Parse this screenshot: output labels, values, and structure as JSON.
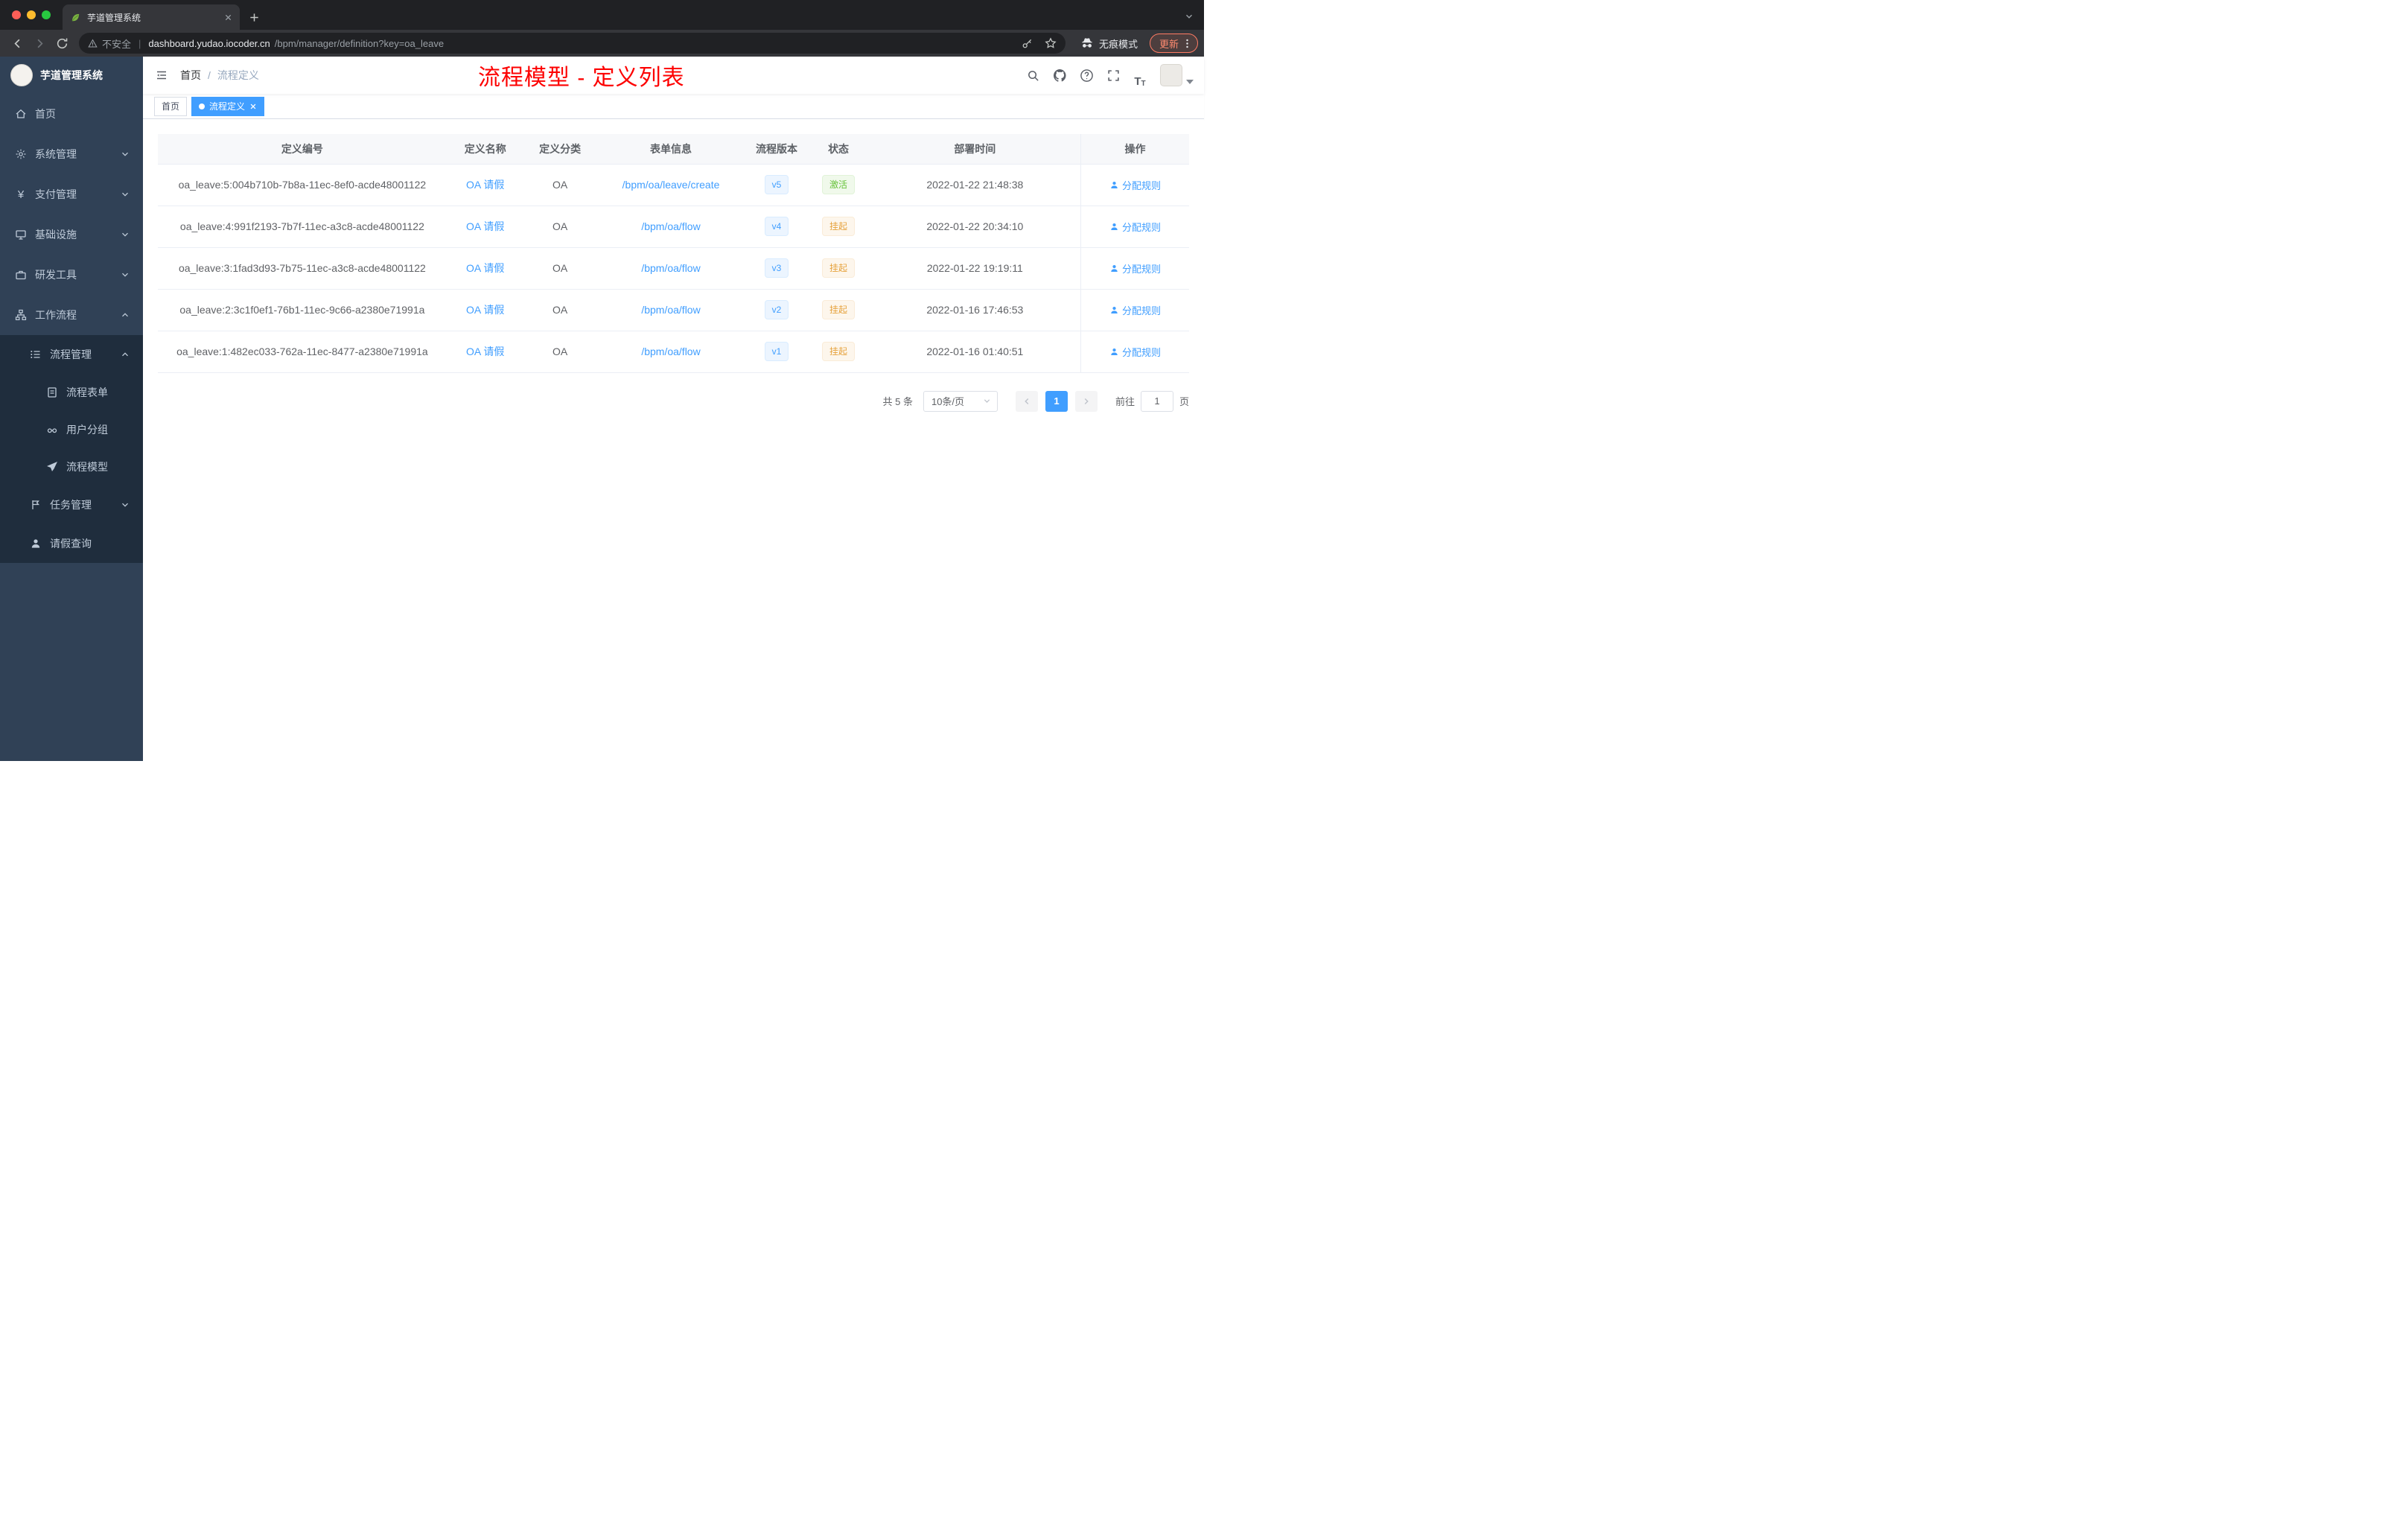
{
  "browser": {
    "tab_title": "芋道管理系统",
    "security_label": "不安全",
    "url_domain": "dashboard.yudao.iocoder.cn",
    "url_path": "/bpm/manager/definition?key=oa_leave",
    "incognito_label": "无痕模式",
    "update_label": "更新"
  },
  "sidebar": {
    "logo_title": "芋道管理系统",
    "items": [
      {
        "label": "首页"
      },
      {
        "label": "系统管理"
      },
      {
        "label": "支付管理"
      },
      {
        "label": "基础设施"
      },
      {
        "label": "研发工具"
      },
      {
        "label": "工作流程"
      },
      {
        "label": "流程管理"
      },
      {
        "label": "流程表单"
      },
      {
        "label": "用户分组"
      },
      {
        "label": "流程模型"
      },
      {
        "label": "任务管理"
      },
      {
        "label": "请假查询"
      }
    ]
  },
  "header": {
    "breadcrumb": {
      "home": "首页",
      "separator": "/",
      "current": "流程定义"
    },
    "annotation": "流程模型 - 定义列表"
  },
  "tags": [
    {
      "label": "首页"
    },
    {
      "label": "流程定义"
    }
  ],
  "table": {
    "columns": [
      "定义编号",
      "定义名称",
      "定义分类",
      "表单信息",
      "流程版本",
      "状态",
      "部署时间",
      "操作"
    ],
    "rows": [
      {
        "id": "oa_leave:5:004b710b-7b8a-11ec-8ef0-acde48001122",
        "name": "OA 请假",
        "category": "OA",
        "form": "/bpm/oa/leave/create",
        "version": "v5",
        "status": "激活",
        "time": "2022-01-22 21:48:38",
        "action": "分配规则"
      },
      {
        "id": "oa_leave:4:991f2193-7b7f-11ec-a3c8-acde48001122",
        "name": "OA 请假",
        "category": "OA",
        "form": "/bpm/oa/flow",
        "version": "v4",
        "status": "挂起",
        "time": "2022-01-22 20:34:10",
        "action": "分配规则"
      },
      {
        "id": "oa_leave:3:1fad3d93-7b75-11ec-a3c8-acde48001122",
        "name": "OA 请假",
        "category": "OA",
        "form": "/bpm/oa/flow",
        "version": "v3",
        "status": "挂起",
        "time": "2022-01-22 19:19:11",
        "action": "分配规则"
      },
      {
        "id": "oa_leave:2:3c1f0ef1-76b1-11ec-9c66-a2380e71991a",
        "name": "OA 请假",
        "category": "OA",
        "form": "/bpm/oa/flow",
        "version": "v2",
        "status": "挂起",
        "time": "2022-01-16 17:46:53",
        "action": "分配规则"
      },
      {
        "id": "oa_leave:1:482ec033-762a-11ec-8477-a2380e71991a",
        "name": "OA 请假",
        "category": "OA",
        "form": "/bpm/oa/flow",
        "version": "v1",
        "status": "挂起",
        "time": "2022-01-16 01:40:51",
        "action": "分配规则"
      }
    ]
  },
  "pagination": {
    "total": "共 5 条",
    "page_size": "10条/页",
    "current_page": "1",
    "goto_label": "前往",
    "goto_value": "1",
    "page_unit": "页"
  },
  "colors": {
    "accent": "#409eff",
    "success": "#67c23a",
    "warning": "#e6a23c",
    "annotation_red": "#fd0000",
    "sidebar_bg": "#304156",
    "sidebar_sub_bg": "#1f2d3d"
  }
}
